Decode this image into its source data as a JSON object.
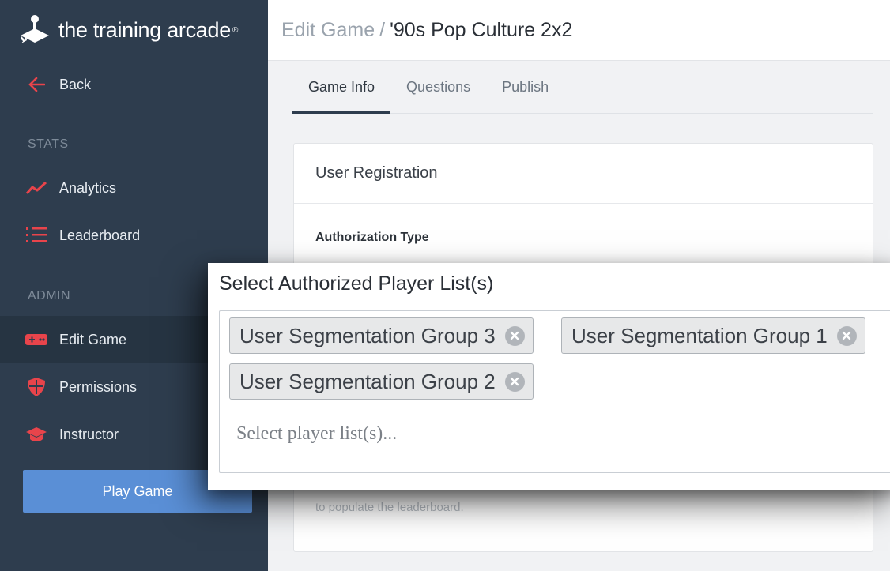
{
  "brand": {
    "name": "the training arcade",
    "mark": "®"
  },
  "sidebar": {
    "back_label": "Back",
    "sections": {
      "stats": "STATS",
      "admin": "ADMIN"
    },
    "items": [
      {
        "label": "Analytics",
        "icon": "analytics-icon"
      },
      {
        "label": "Leaderboard",
        "icon": "leaderboard-icon"
      },
      {
        "label": "Edit Game",
        "icon": "gamepad-icon"
      },
      {
        "label": "Permissions",
        "icon": "shield-icon"
      },
      {
        "label": "Instructor",
        "icon": "graduation-cap-icon"
      }
    ],
    "play_button": "Play Game"
  },
  "header": {
    "section": "Edit Game",
    "separator": "/",
    "title": "'90s Pop Culture 2x2"
  },
  "tabs": [
    {
      "label": "Game Info",
      "active": true
    },
    {
      "label": "Questions",
      "active": false
    },
    {
      "label": "Publish",
      "active": false
    }
  ],
  "card": {
    "title": "User Registration",
    "field_label": "Authorization Type",
    "help_text": "to populate the leaderboard."
  },
  "overlay": {
    "title": "Select Authorized Player List(s)",
    "chips": [
      "User Segmentation Group 3",
      "User Segmentation Group 1",
      "User Segmentation Group 2"
    ],
    "placeholder": "Select player list(s)..."
  },
  "colors": {
    "sidebar_bg": "#2e3d4e",
    "accent_red": "#e8444b",
    "play_button": "#5a8fd6"
  }
}
